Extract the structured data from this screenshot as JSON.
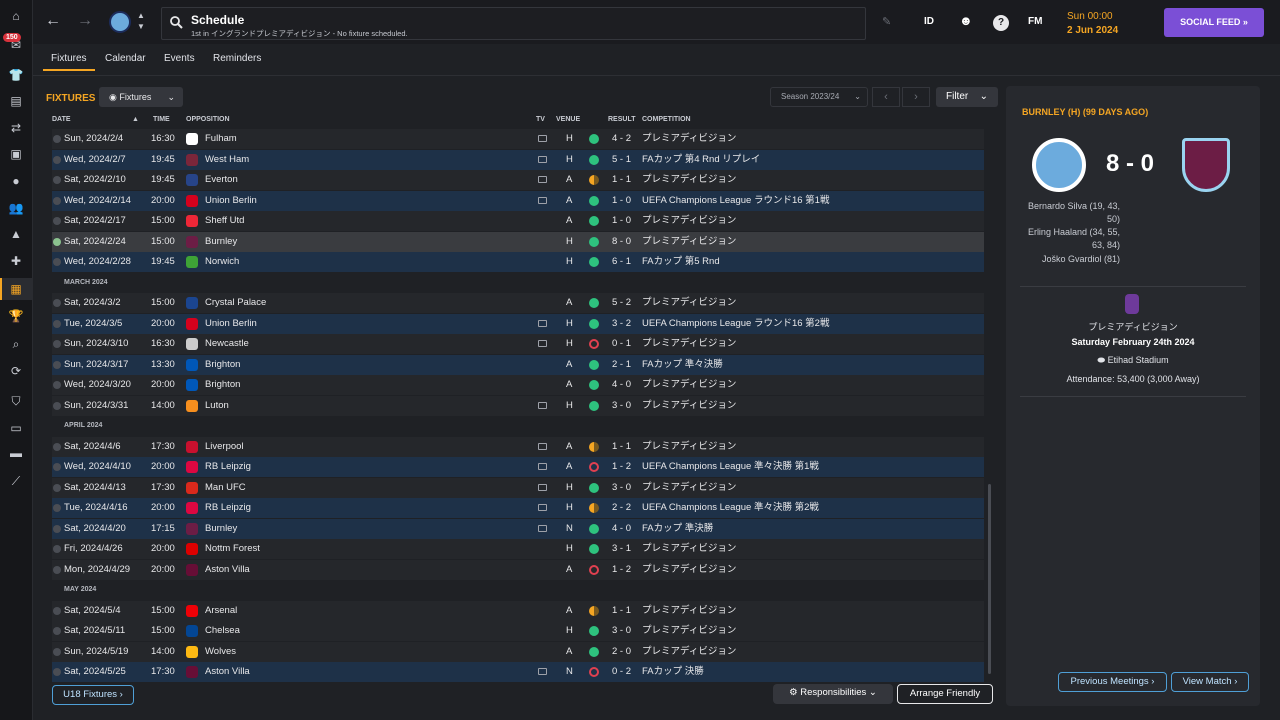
{
  "nav": {
    "badge": "150"
  },
  "topbar": {
    "title": "Schedule",
    "subtitle": "1st in イングランドプレミアディビジョン - No fixture scheduled.",
    "id_label": "ID",
    "fm_label": "FM",
    "help_label": "?",
    "time": "Sun 00:00",
    "date": "2 Jun 2024",
    "social_feed": "SOCIAL FEED »"
  },
  "tabs": [
    "Fixtures",
    "Calendar",
    "Events",
    "Reminders"
  ],
  "fixtures": {
    "section_title": "FIXTURES",
    "view_dropdown": "Fixtures",
    "season": "Season 2023/24",
    "filter": "Filter",
    "columns": {
      "date": "DATE",
      "time": "TIME",
      "opposition": "OPPOSITION",
      "tv": "TV",
      "venue": "VENUE",
      "result": "RESULT",
      "competition": "COMPETITION"
    },
    "rows": [
      {
        "kind": "match",
        "style": "plain",
        "date": "Sun, 2024/2/4",
        "time": "16:30",
        "opp": "Fulham",
        "crest": "#ffffff",
        "tv": true,
        "venue": "H",
        "res": "win",
        "score": "4 - 2",
        "comp": "プレミアディビジョン"
      },
      {
        "kind": "match",
        "style": "band",
        "date": "Wed, 2024/2/7",
        "time": "19:45",
        "opp": "West Ham",
        "crest": "#7a263a",
        "tv": true,
        "venue": "H",
        "res": "win",
        "score": "5 - 1",
        "comp": "FAカップ 第4 Rnd リプレイ"
      },
      {
        "kind": "match",
        "style": "plain",
        "date": "Sat, 2024/2/10",
        "time": "19:45",
        "opp": "Everton",
        "crest": "#274488",
        "tv": true,
        "venue": "A",
        "res": "draw",
        "score": "1 - 1",
        "comp": "プレミアディビジョン"
      },
      {
        "kind": "match",
        "style": "band",
        "date": "Wed, 2024/2/14",
        "time": "20:00",
        "opp": "Union Berlin",
        "crest": "#d4011d",
        "tv": true,
        "venue": "A",
        "res": "win",
        "score": "1 - 0",
        "comp": "UEFA Champions League ラウンド16 第1戦"
      },
      {
        "kind": "match",
        "style": "plain",
        "date": "Sat, 2024/2/17",
        "time": "15:00",
        "opp": "Sheff Utd",
        "crest": "#ee2737",
        "tv": false,
        "venue": "A",
        "res": "win",
        "score": "1 - 0",
        "comp": "プレミアディビジョン"
      },
      {
        "kind": "match",
        "style": "selected",
        "date": "Sat, 2024/2/24",
        "time": "15:00",
        "opp": "Burnley",
        "crest": "#6c1d45",
        "tv": false,
        "venue": "H",
        "res": "win",
        "score": "8 - 0",
        "comp": "プレミアディビジョン"
      },
      {
        "kind": "match",
        "style": "band",
        "date": "Wed, 2024/2/28",
        "time": "19:45",
        "opp": "Norwich",
        "crest": "#3ea336",
        "tv": false,
        "venue": "H",
        "res": "win",
        "score": "6 - 1",
        "comp": "FAカップ 第5 Rnd"
      },
      {
        "kind": "month",
        "label": "MARCH 2024"
      },
      {
        "kind": "match",
        "style": "plain",
        "date": "Sat, 2024/3/2",
        "time": "15:00",
        "opp": "Crystal Palace",
        "crest": "#1b458f",
        "tv": false,
        "venue": "A",
        "res": "win",
        "score": "5 - 2",
        "comp": "プレミアディビジョン"
      },
      {
        "kind": "match",
        "style": "band",
        "date": "Tue, 2024/3/5",
        "time": "20:00",
        "opp": "Union Berlin",
        "crest": "#d4011d",
        "tv": true,
        "venue": "H",
        "res": "win",
        "score": "3 - 2",
        "comp": "UEFA Champions League ラウンド16 第2戦"
      },
      {
        "kind": "match",
        "style": "plain",
        "date": "Sun, 2024/3/10",
        "time": "16:30",
        "opp": "Newcastle",
        "crest": "#cccccc",
        "tv": true,
        "venue": "H",
        "res": "loss",
        "score": "0 - 1",
        "comp": "プレミアディビジョン"
      },
      {
        "kind": "match",
        "style": "band",
        "date": "Sun, 2024/3/17",
        "time": "13:30",
        "opp": "Brighton",
        "crest": "#0057b8",
        "tv": false,
        "venue": "A",
        "res": "win",
        "score": "2 - 1",
        "comp": "FAカップ 準々決勝"
      },
      {
        "kind": "match",
        "style": "plain",
        "date": "Wed, 2024/3/20",
        "time": "20:00",
        "opp": "Brighton",
        "crest": "#0057b8",
        "tv": false,
        "venue": "A",
        "res": "win",
        "score": "4 - 0",
        "comp": "プレミアディビジョン"
      },
      {
        "kind": "match",
        "style": "plain",
        "date": "Sun, 2024/3/31",
        "time": "14:00",
        "opp": "Luton",
        "crest": "#f78f1e",
        "tv": true,
        "venue": "H",
        "res": "win",
        "score": "3 - 0",
        "comp": "プレミアディビジョン"
      },
      {
        "kind": "month",
        "label": "APRIL 2024"
      },
      {
        "kind": "match",
        "style": "plain",
        "date": "Sat, 2024/4/6",
        "time": "17:30",
        "opp": "Liverpool",
        "crest": "#c8102e",
        "tv": true,
        "venue": "A",
        "res": "draw",
        "score": "1 - 1",
        "comp": "プレミアディビジョン"
      },
      {
        "kind": "match",
        "style": "band",
        "date": "Wed, 2024/4/10",
        "time": "20:00",
        "opp": "RB Leipzig",
        "crest": "#dd0741",
        "tv": true,
        "venue": "A",
        "res": "loss",
        "score": "1 - 2",
        "comp": "UEFA Champions League 準々決勝 第1戦"
      },
      {
        "kind": "match",
        "style": "plain",
        "date": "Sat, 2024/4/13",
        "time": "17:30",
        "opp": "Man UFC",
        "crest": "#da291c",
        "tv": true,
        "venue": "H",
        "res": "win",
        "score": "3 - 0",
        "comp": "プレミアディビジョン"
      },
      {
        "kind": "match",
        "style": "band",
        "date": "Tue, 2024/4/16",
        "time": "20:00",
        "opp": "RB Leipzig",
        "crest": "#dd0741",
        "tv": true,
        "venue": "H",
        "res": "draw",
        "score": "2 - 2",
        "comp": "UEFA Champions League 準々決勝 第2戦"
      },
      {
        "kind": "match",
        "style": "band",
        "date": "Sat, 2024/4/20",
        "time": "17:15",
        "opp": "Burnley",
        "crest": "#6c1d45",
        "tv": true,
        "venue": "N",
        "res": "win",
        "score": "4 - 0",
        "comp": "FAカップ 準決勝"
      },
      {
        "kind": "match",
        "style": "plain",
        "date": "Fri, 2024/4/26",
        "time": "20:00",
        "opp": "Nottm Forest",
        "crest": "#dd0000",
        "tv": false,
        "venue": "H",
        "res": "win",
        "score": "3 - 1",
        "comp": "プレミアディビジョン"
      },
      {
        "kind": "match",
        "style": "plain",
        "date": "Mon, 2024/4/29",
        "time": "20:00",
        "opp": "Aston Villa",
        "crest": "#670e36",
        "tv": false,
        "venue": "A",
        "res": "loss",
        "score": "1 - 2",
        "comp": "プレミアディビジョン"
      },
      {
        "kind": "month",
        "label": "MAY 2024"
      },
      {
        "kind": "match",
        "style": "plain",
        "date": "Sat, 2024/5/4",
        "time": "15:00",
        "opp": "Arsenal",
        "crest": "#ef0107",
        "tv": false,
        "venue": "A",
        "res": "draw",
        "score": "1 - 1",
        "comp": "プレミアディビジョン"
      },
      {
        "kind": "match",
        "style": "plain",
        "date": "Sat, 2024/5/11",
        "time": "15:00",
        "opp": "Chelsea",
        "crest": "#034694",
        "tv": false,
        "venue": "H",
        "res": "win",
        "score": "3 - 0",
        "comp": "プレミアディビジョン"
      },
      {
        "kind": "match",
        "style": "plain",
        "date": "Sun, 2024/5/19",
        "time": "14:00",
        "opp": "Wolves",
        "crest": "#fdb913",
        "tv": false,
        "venue": "A",
        "res": "win",
        "score": "2 - 0",
        "comp": "プレミアディビジョン"
      },
      {
        "kind": "match",
        "style": "band",
        "date": "Sat, 2024/5/25",
        "time": "17:30",
        "opp": "Aston Villa",
        "crest": "#670e36",
        "tv": true,
        "venue": "N",
        "res": "loss",
        "score": "0 - 2",
        "comp": "FAカップ 決勝"
      }
    ],
    "u18_button": "U18 Fixtures ›",
    "responsibilities": "Responsibilities",
    "arrange_friendly": "Arrange Friendly"
  },
  "match_panel": {
    "title": "BURNLEY (H) (99 DAYS AGO)",
    "score": "8 - 0",
    "scorers": [
      {
        "line1": "Bernardo Silva (19, 43,",
        "line2": "50)"
      },
      {
        "line1": "Erling Haaland (34, 55,",
        "line2": "63, 84)"
      },
      {
        "line1": "Joško Gvardiol (81)",
        "line2": ""
      }
    ],
    "competition": "プレミアディビジョン",
    "date": "Saturday February 24th 2024",
    "stadium": "Etihad Stadium",
    "attendance": "Attendance: 53,400 (3,000 Away)",
    "previous_meetings": "Previous Meetings ›",
    "view_match": "View Match ›"
  }
}
